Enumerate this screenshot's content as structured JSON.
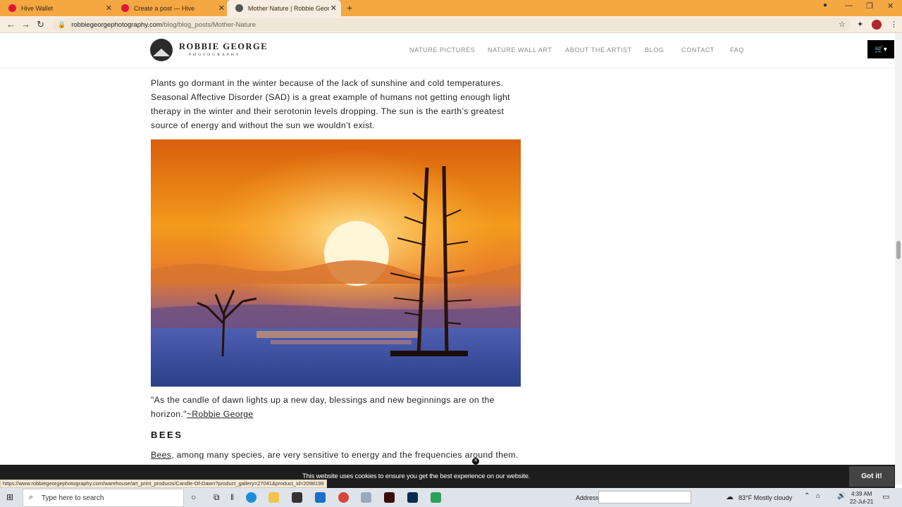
{
  "browser": {
    "tabs": [
      {
        "title": "Hive Wallet",
        "favicon_color": "#e31337"
      },
      {
        "title": "Create a post — Hive",
        "favicon_color": "#e31337"
      },
      {
        "title": "Mother Nature | Robbie George",
        "favicon_color": "#555555"
      }
    ],
    "url_domain": "robbiegeorgephotography.com",
    "url_path": "/blog/blog_posts/Mother-Nature"
  },
  "site": {
    "logo_name": "ROBBIE GEORGE",
    "logo_sub": "PHOTOGRAPHY",
    "menu": [
      "NATURE PICTURES",
      "NATURE WALL ART",
      "ABOUT THE ARTIST",
      "BLOG",
      "CONTACT",
      "FAQ"
    ],
    "cart_icon": "cart-icon"
  },
  "article": {
    "para1_lines": [
      "Plants go dormant in the winter because of the lack of sunshine and cold temperatures.",
      "Seasonal Affective Disorder (SAD) is a great example of humans not getting enough light",
      "therapy in the winter and their serotonin levels dropping. The sun is the earth’s greatest",
      "source of energy and without the sun we wouldn’t exist."
    ],
    "quote_line1": "\"As the candle of dawn lights up a new day, blessings and new beginnings are on the",
    "quote_line2_prefix": "horizon.\"",
    "quote_author": "~Robbie George",
    "heading": "BEES",
    "bees_link": "Bees",
    "bees_text": ", among many species, are very sensitive to energy and the frequencies around them."
  },
  "cookie": {
    "text": "This website uses cookies to ensure you get the best experience on our website.",
    "button": "Got it!"
  },
  "status_url": "https://www.robbiegeorgephotography.com/warehouse/art_print_products/Candle-Of-Dawn?product_gallery=27041&product_id=2098199",
  "taskbar": {
    "search_placeholder": "Type here to search",
    "address_label": "Address",
    "temperature": "83°F",
    "weather": "Mostly cloudy",
    "time": "4:39 AM",
    "date": "22-Jul-21"
  }
}
